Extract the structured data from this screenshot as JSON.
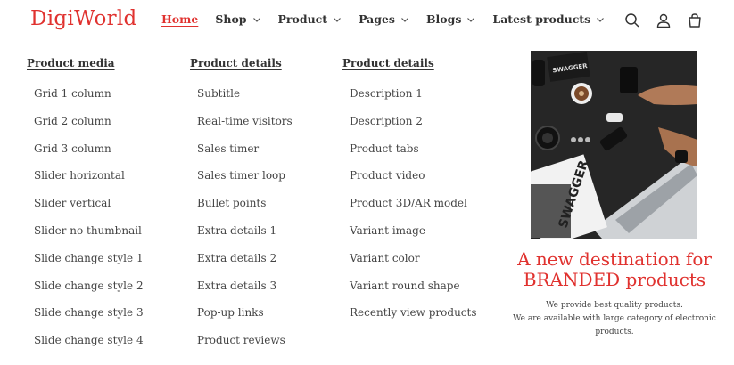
{
  "header": {
    "logo": "DigiWorld",
    "nav": [
      {
        "label": "Home"
      },
      {
        "label": "Shop"
      },
      {
        "label": "Product"
      },
      {
        "label": "Pages"
      },
      {
        "label": "Blogs"
      },
      {
        "label": "Latest products"
      }
    ],
    "icons": [
      "search-icon",
      "account-icon",
      "cart-icon"
    ]
  },
  "menu": {
    "columns": [
      {
        "heading": "Product media",
        "items": [
          "Grid 1 column",
          "Grid 2 column",
          "Grid 3 column",
          "Slider horizontal",
          "Slider vertical",
          "Slider no thumbnail",
          "Slide change style 1",
          "Slide change style 2",
          "Slide change style 3",
          "Slide change style 4"
        ]
      },
      {
        "heading": "Product details",
        "items": [
          "Subtitle",
          "Real-time visitors",
          "Sales timer",
          "Sales timer loop",
          "Bullet points",
          "Extra details 1",
          "Extra details 2",
          "Extra details 3",
          "Pop-up links",
          "Product reviews"
        ]
      },
      {
        "heading": "Product details",
        "items": [
          "Description 1",
          "Description 2",
          "Product tabs",
          "Product video",
          "Product 3D/AR model",
          "Variant image",
          "Variant color",
          "Variant round shape",
          "Recently view products"
        ]
      }
    ]
  },
  "promo": {
    "image_text_1": "SWAGGER",
    "image_text_2": "SWAGGER",
    "title_line1": "A new destination for",
    "title_line2": "BRANDED products",
    "text_line1": "We provide best quality products.",
    "text_line2": "We are available with large category of electronic",
    "text_line3": "products."
  },
  "colors": {
    "accent": "#e0322f",
    "text": "#333333"
  }
}
